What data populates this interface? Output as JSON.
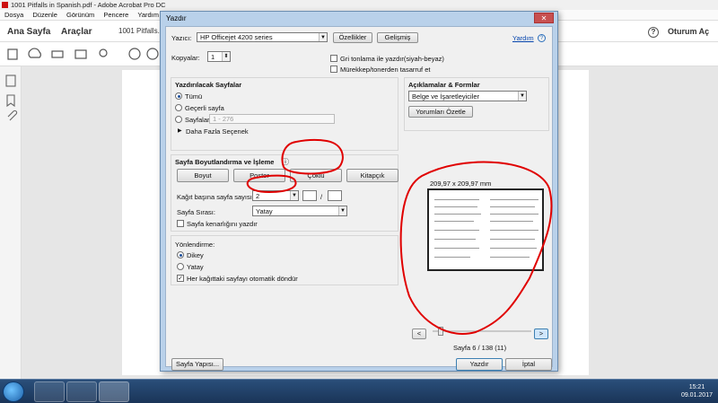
{
  "window": {
    "title": "1001 Pitfalls in Spanish.pdf - Adobe Acrobat Pro DC"
  },
  "menu": [
    "Dosya",
    "Düzenle",
    "Görünüm",
    "Pencere",
    "Yardım"
  ],
  "tabs": {
    "home": "Ana Sayfa",
    "tools": "Araçlar",
    "doc": "1001 Pitfalls...",
    "signin": "Oturum Aç",
    "help": "?"
  },
  "dialog": {
    "title": "Yazdır",
    "close": "✕",
    "printer_label": "Yazıcı:",
    "printer_value": "HP Officejet 4200 series",
    "properties_btn": "Özellikler",
    "advanced_btn": "Gelişmiş",
    "help_link": "Yardım",
    "copies_label": "Kopyalar:",
    "copies_value": "1",
    "grayscale_label": "Gri tonlama ile yazdır(siyah-beyaz)",
    "grayscale_checked": false,
    "ink_save_label": "Mürekkep/tonerden tasarruf et",
    "ink_save_checked": false,
    "pages_section": {
      "title": "Yazdırılacak Sayfalar",
      "all": "Tümü",
      "current": "Geçerli sayfa",
      "pages": "Sayfalar",
      "pages_value": "1 - 276",
      "more": "Daha Fazla Seçenek"
    },
    "comments_section": {
      "title": "Açıklamalar & Formlar",
      "value": "Belge ve İşaretleyiciler",
      "summarize_btn": "Yorumları Özetle"
    },
    "sizing_section": {
      "title": "Sayfa Boyutlandırma ve İşleme",
      "info": "ⓘ",
      "buttons": [
        "Boyut",
        "Poster",
        "Çoklu",
        "Kitapçık"
      ],
      "pages_per_sheet_label": "Kağıt başına sayfa sayısı:",
      "pages_per_sheet_value": "2",
      "slash": "/",
      "order_label": "Sayfa Sırası:",
      "order_value": "Yatay",
      "border_label": "Sayfa kenarlığını yazdır"
    },
    "orientation_section": {
      "title": "Yönlendirme:",
      "portrait": "Dikey",
      "landscape": "Yatay",
      "autorotate": "Her kağıttaki sayfayı otomatik döndür",
      "autorotate_checked": true
    },
    "preview": {
      "size_label": "209,97 x 209,97 mm",
      "page_label": "Sayfa 6 / 138 (11)",
      "prev": "<",
      "next": ">"
    },
    "page_setup_btn": "Sayfa Yapısı...",
    "print_btn": "Yazdır",
    "cancel_btn": "İptal"
  },
  "taskbar": {
    "time": "15:21",
    "date": "09.01.2017"
  },
  "colors": {
    "annotation": "#e00000",
    "dialog_frame": "#b9d1ea",
    "taskbar": "#1e3c63"
  }
}
